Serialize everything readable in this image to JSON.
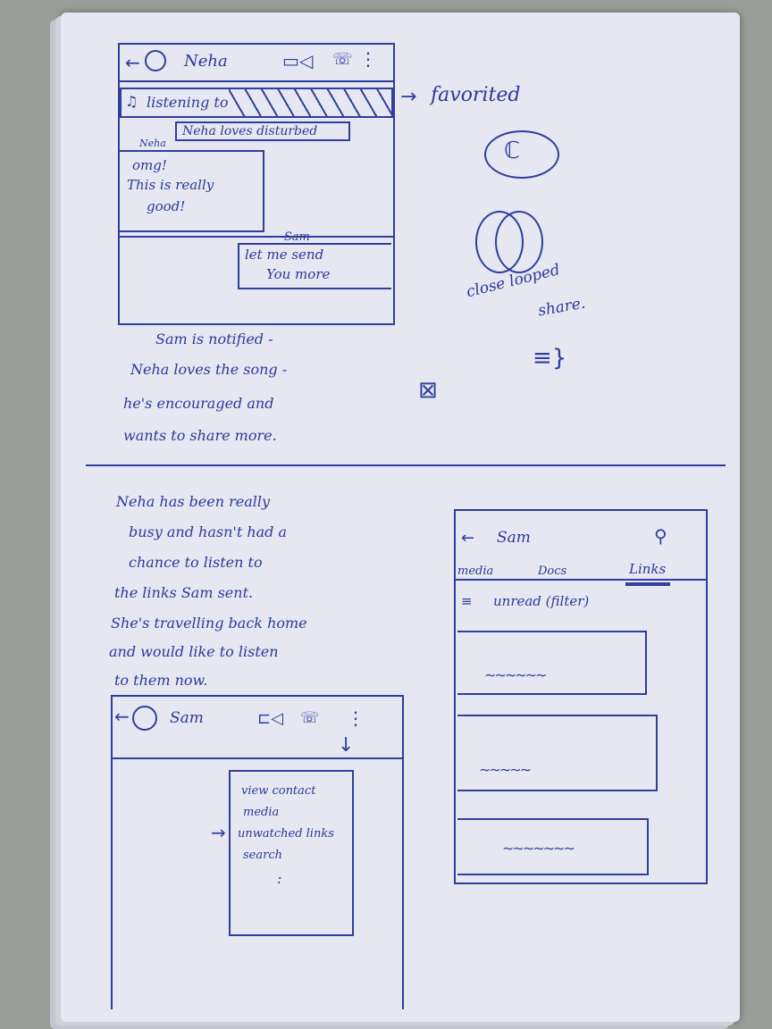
{
  "mockup1": {
    "contact_name": "Neha",
    "listening_bar": "listening to",
    "notice": "Neha loves disturbed",
    "bubble_sender": "Neha",
    "bubble_lines": [
      "omg!",
      "This   is really",
      "good!"
    ],
    "reply_sender": "Sam",
    "reply_lines": [
      "let me send",
      "You more"
    ]
  },
  "side_notes": {
    "favorited": "favorited",
    "close_looped_1": "close looped",
    "close_looped_2": "share."
  },
  "caption1": [
    "Sam is notified -",
    "Neha loves the song -",
    "he's encouraged and",
    "wants to share more."
  ],
  "caption2": [
    "Neha has been really",
    "busy and hasn't had a",
    "chance to listen to",
    "the links Sam sent.",
    "She's travelling back home",
    "and would like to listen",
    "to them now."
  ],
  "mockup2": {
    "contact_name": "Sam",
    "menu_items": [
      "view contact",
      "media",
      "unwatched links",
      "search"
    ],
    "menu_more": ":"
  },
  "mockup3": {
    "contact_name": "Sam",
    "tabs": [
      "media",
      "Docs",
      "Links"
    ],
    "filter_label": "unread (filter)"
  },
  "colors": {
    "ink": "#2a3a9c",
    "paper": "#e6e7f0",
    "background": "#9a9d98"
  }
}
